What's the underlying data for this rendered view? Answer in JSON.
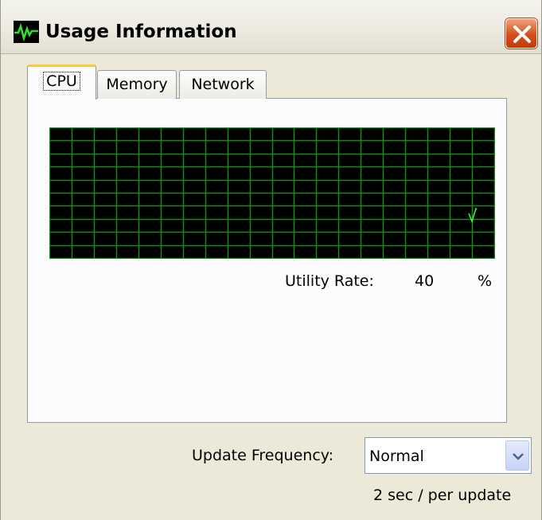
{
  "window": {
    "title": "Usage Information"
  },
  "tabs": [
    {
      "label": "CPU",
      "active": true
    },
    {
      "label": "Memory",
      "active": false
    },
    {
      "label": "Network",
      "active": false
    }
  ],
  "cpu": {
    "utility_label": "Utility Rate:",
    "utility_value": "40",
    "utility_unit": "%"
  },
  "update": {
    "frequency_label": "Update Frequency:",
    "frequency_value": "Normal",
    "interval_text": "2 sec / per update"
  },
  "colors": {
    "graph_background": "#000000",
    "graph_grid": "#1a8a1a",
    "graph_line": "#39ff39"
  },
  "icons": {
    "app": "activity-monitor-icon",
    "close": "close-icon",
    "dropdown": "chevron-down-icon"
  }
}
